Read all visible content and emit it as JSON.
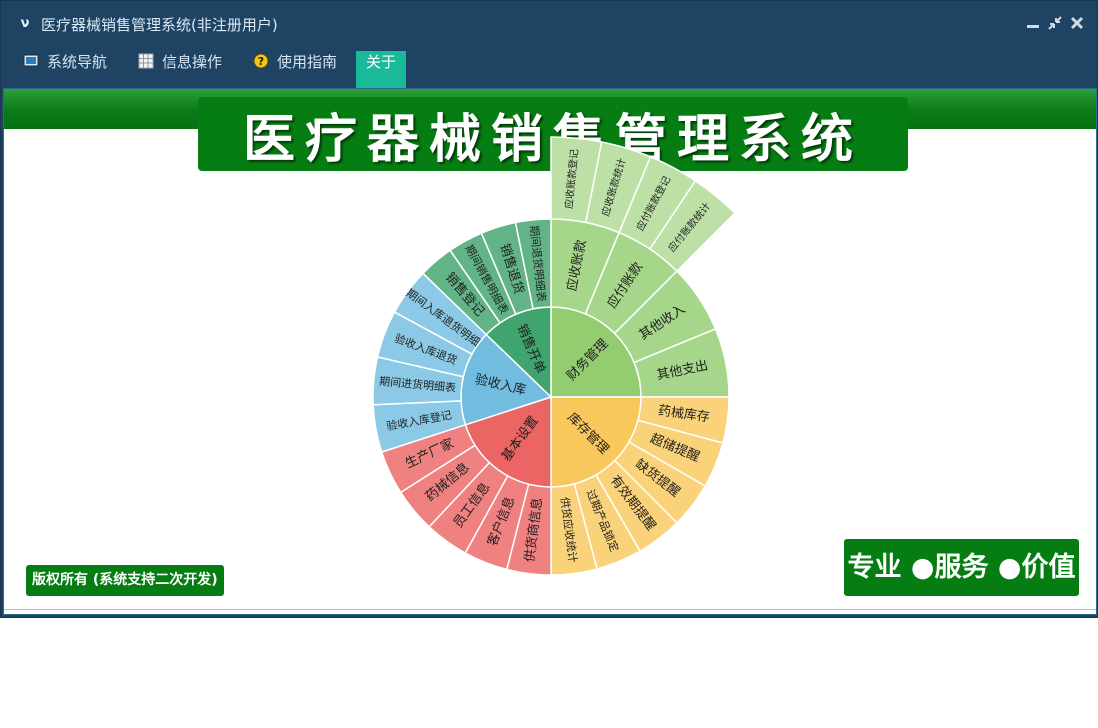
{
  "window": {
    "title": "医疗器械销售管理系统(非注册用户)",
    "logo_icon": "app-logo-icon",
    "controls": [
      "minimize-icon",
      "restore-icon",
      "close-icon"
    ]
  },
  "menu": {
    "items": [
      {
        "label": "系统导航",
        "icon": "monitor-icon"
      },
      {
        "label": "信息操作",
        "icon": "grid-icon"
      },
      {
        "label": "使用指南",
        "icon": "help-icon"
      },
      {
        "label": "关于",
        "icon": "",
        "active": true
      }
    ]
  },
  "banner": {
    "title": "医疗器械销售管理系统"
  },
  "sunburst": {
    "sections": [
      {
        "label": "财务管理",
        "color": "#93cd6f",
        "children": [
          "应收账款",
          "应付账款",
          "其他收入",
          "其他支出"
        ]
      },
      {
        "label": "库存管理",
        "color": "#f9c85c",
        "children": [
          "药械库存",
          "超储提醒",
          "缺货提醒",
          "有效期提醒",
          "过期产品锁定",
          "供货应收统计"
        ]
      },
      {
        "label": "基本设置",
        "color": "#ec6565",
        "children": [
          "供货商信息",
          "客户信息",
          "员工信息",
          "药械信息",
          "生产厂家"
        ]
      },
      {
        "label": "验收入库",
        "color": "#71bde0",
        "children": [
          "验收入库登记",
          "期间进货明细表",
          "验收入库退货",
          "期间入库退货明细"
        ]
      },
      {
        "label": "销售开单",
        "color": "#3fa46d",
        "children": [
          "销售登记",
          "期间销售明细表",
          "销售退货",
          "期间退货明细表"
        ]
      }
    ],
    "outer": [
      "应收账款登记",
      "应收账款统计",
      "应付账款登记",
      "应付账款统计"
    ]
  },
  "footer": {
    "copyright": "版权所有 (系统支持二次开发)",
    "slogan": "专业 ●服务 ●价值"
  },
  "colors": {
    "chrome": "#1e4363",
    "active_tab": "#1ab99a",
    "brand_green": "#067d12"
  }
}
